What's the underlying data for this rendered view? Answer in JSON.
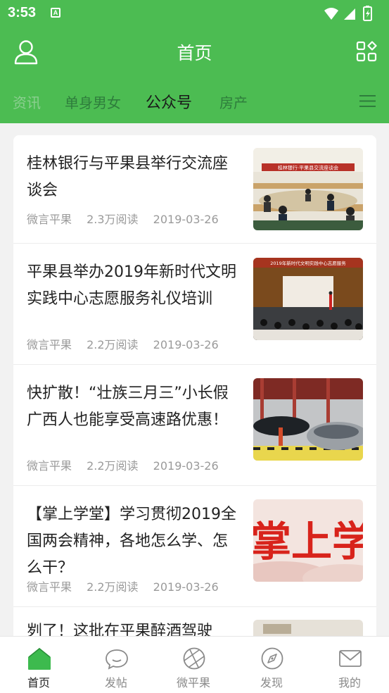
{
  "status_bar": {
    "time": "3:53",
    "badge": "A"
  },
  "header": {
    "title": "首页",
    "tabs": [
      {
        "label": "资讯"
      },
      {
        "label": "单身男女"
      },
      {
        "label": "公众号"
      },
      {
        "label": "房产"
      }
    ],
    "active_tab": "公众号"
  },
  "feed": {
    "items": [
      {
        "title": "桂林银行与平果县举行交流座谈会",
        "source": "微言平果",
        "reads": "2.3万阅读",
        "date": "2019-03-26",
        "banner_text": "桂林银行·平果县交流座谈会"
      },
      {
        "title": "平果县举办2019年新时代文明实践中心志愿服务礼仪培训",
        "source": "微言平果",
        "reads": "2.2万阅读",
        "date": "2019-03-26",
        "banner_text": "2019年新时代文明实践中心志愿服务"
      },
      {
        "title": "快扩散！“壮族三月三”小长假广西人也能享受高速路优惠！",
        "source": "微言平果",
        "reads": "2.2万阅读",
        "date": "2019-03-26"
      },
      {
        "title": "【掌上学堂】学习贯彻2019全国两会精神，各地怎么学、怎么干？",
        "source": "微言平果",
        "reads": "2.2万阅读",
        "date": "2019-03-26",
        "banner_text": "掌上学"
      },
      {
        "title": "刿了！这批在平果醉酒驾驶"
      }
    ]
  },
  "tabbar": {
    "items": [
      {
        "label": "首页",
        "icon": "home-icon",
        "active": true
      },
      {
        "label": "发帖",
        "icon": "chat-bubble-icon"
      },
      {
        "label": "微平果",
        "icon": "aperture-icon"
      },
      {
        "label": "发现",
        "icon": "compass-icon"
      },
      {
        "label": "我的",
        "icon": "mail-icon"
      }
    ]
  },
  "colors": {
    "brand_green": "#4cbc52",
    "active_icon_green": "#3dba4e"
  }
}
